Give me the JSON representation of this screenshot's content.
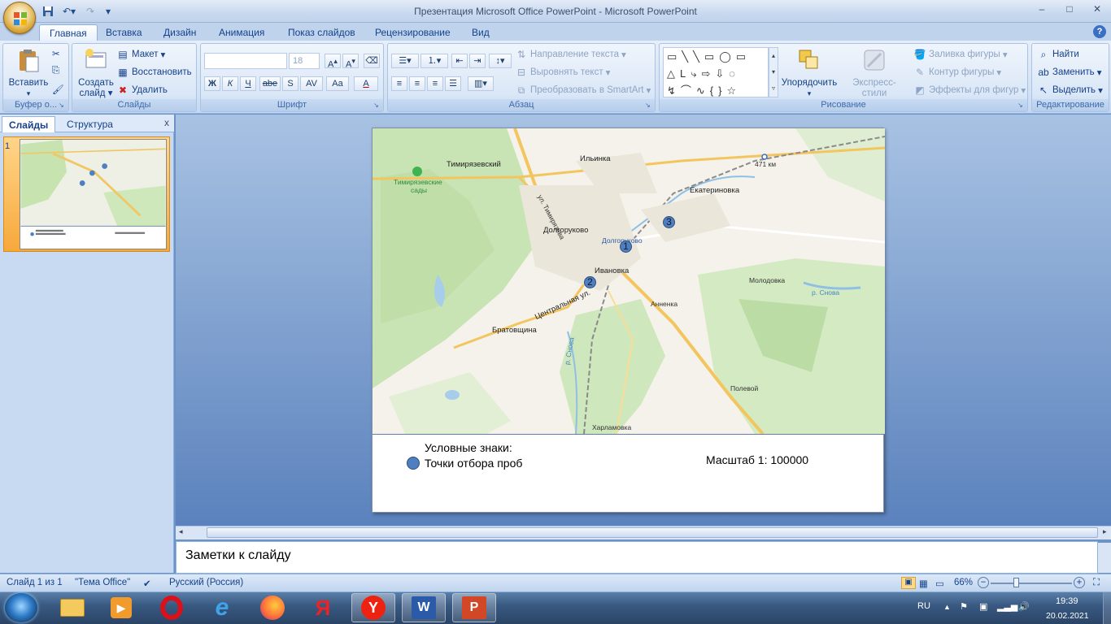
{
  "window": {
    "title": "Презентация Microsoft Office PowerPoint - Microsoft PowerPoint",
    "controls": [
      "–",
      "□",
      "✕"
    ]
  },
  "ribbon_tabs": [
    "Главная",
    "Вставка",
    "Дизайн",
    "Анимация",
    "Показ слайдов",
    "Рецензирование",
    "Вид"
  ],
  "clipboard": {
    "label": "Буфер о...",
    "paste": "Вставить"
  },
  "slides_group": {
    "label": "Слайды",
    "create": "Создать",
    "create2": "слайд",
    "layout": "Макет",
    "reset": "Восстановить",
    "delete": "Удалить"
  },
  "font_group": {
    "label": "Шрифт",
    "font_name": "",
    "font_size": "18",
    "bold": "Ж",
    "italic": "К",
    "underline": "Ч",
    "strike": "abe",
    "shadow": "S",
    "spacing": "AV",
    "case": "Aa",
    "color": "A"
  },
  "paragraph_group": {
    "label": "Абзац",
    "text_direction": "Направление текста",
    "align_text": "Выровнять текст",
    "smartart": "Преобразовать в SmartArt"
  },
  "drawing_group": {
    "label": "Рисование",
    "arrange": "Упорядочить",
    "quick_styles": "Экспресс-стили",
    "fill": "Заливка фигуры",
    "outline": "Контур фигуры",
    "effects": "Эффекты для фигур"
  },
  "editing_group": {
    "label": "Редактирование",
    "find": "Найти",
    "replace": "Заменить",
    "select": "Выделить"
  },
  "left_panel": {
    "tab_slides": "Слайды",
    "tab_outline": "Структура",
    "slide_number": "1",
    "close": "x"
  },
  "slide": {
    "map_labels": {
      "timiryazevsky": "Тимирязевский",
      "timiryazevskie": "Тимирязевские",
      "sady": "сады",
      "ilyinka": "Ильинка",
      "km471": "471 км",
      "ekaterinovka": "Екатериновка",
      "timiryazeva_st": "ул. Тимирязева",
      "dolgorukovo": "Долгоруково",
      "dolgorukovo_station": "Долгоруково",
      "ivanovka": "Ивановка",
      "molodovka": "Молодовка",
      "snova": "р. Снова",
      "annenka": "Анненка",
      "centralnaya": "Центральная ул.",
      "bratovshchina": "Братовщина",
      "snova2": "р. Снова",
      "polevoy": "Полевой",
      "kharlamovka": "Харламовка"
    },
    "points": [
      "1",
      "2",
      "3"
    ],
    "legend_title": "Условные знаки:",
    "legend_item": "Точки отбора проб",
    "scale": "Масштаб 1: 100000"
  },
  "notes": "Заметки к слайду",
  "status": {
    "slide_of": "Слайд 1 из 1",
    "theme": "\"Тема Office\"",
    "language": "Русский (Россия)",
    "zoom": "66%"
  },
  "tray": {
    "lang": "RU",
    "time": "19:39",
    "date": "20.02.2021"
  },
  "colors": {
    "accent": "#15428b",
    "ribbon": "#dae7f7",
    "point": "#4f7fbf",
    "taskbar": "#3a5a82"
  }
}
